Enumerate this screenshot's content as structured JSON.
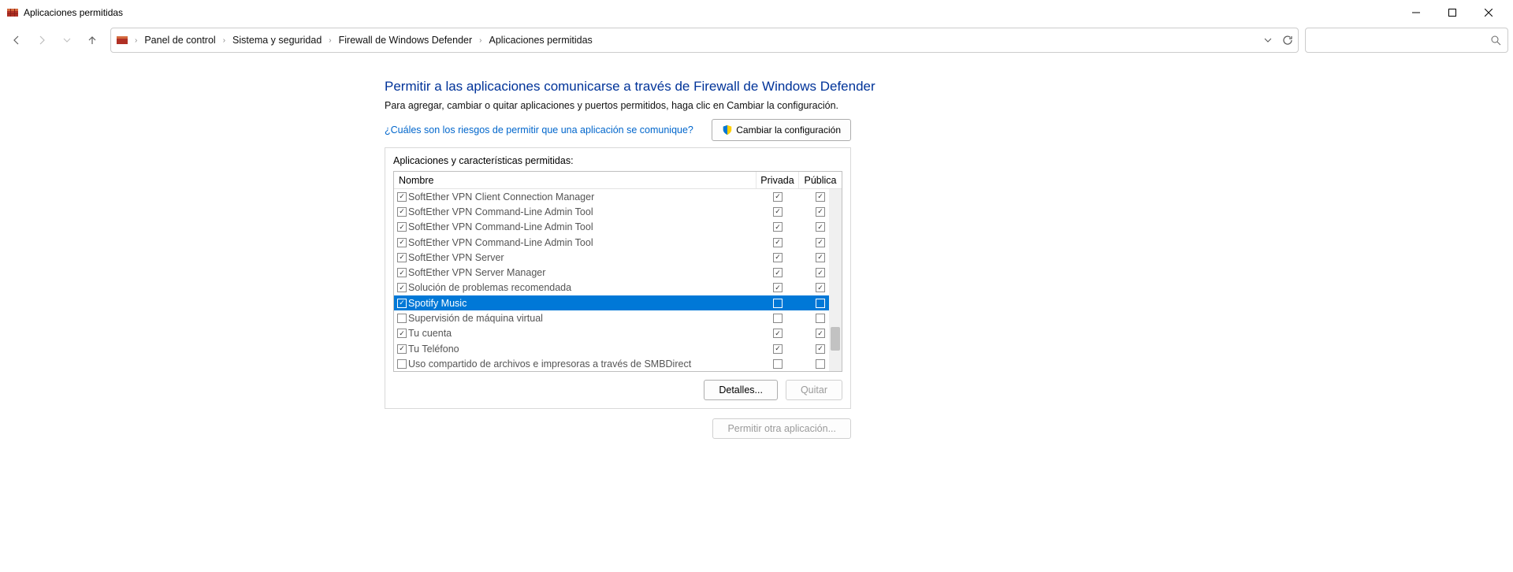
{
  "titlebar": {
    "title": "Aplicaciones permitidas"
  },
  "breadcrumb": [
    "Panel de control",
    "Sistema y seguridad",
    "Firewall de Windows Defender",
    "Aplicaciones permitidas"
  ],
  "heading": "Permitir a las aplicaciones comunicarse a través de Firewall de Windows Defender",
  "subtext": "Para agregar, cambiar o quitar aplicaciones y puertos permitidos, haga clic en Cambiar la configuración.",
  "risklink": "¿Cuáles son los riesgos de permitir que una aplicación se comunique?",
  "changebtn": "Cambiar la configuración",
  "panel_label": "Aplicaciones y características permitidas:",
  "cols": {
    "name": "Nombre",
    "private": "Privada",
    "public": "Pública"
  },
  "rows": [
    {
      "enabled": true,
      "name": "SoftEther VPN Client Connection Manager",
      "priv": true,
      "pub": true,
      "selected": false
    },
    {
      "enabled": true,
      "name": "SoftEther VPN Command-Line Admin Tool",
      "priv": true,
      "pub": true,
      "selected": false
    },
    {
      "enabled": true,
      "name": "SoftEther VPN Command-Line Admin Tool",
      "priv": true,
      "pub": true,
      "selected": false
    },
    {
      "enabled": true,
      "name": "SoftEther VPN Command-Line Admin Tool",
      "priv": true,
      "pub": true,
      "selected": false
    },
    {
      "enabled": true,
      "name": "SoftEther VPN Server",
      "priv": true,
      "pub": true,
      "selected": false
    },
    {
      "enabled": true,
      "name": "SoftEther VPN Server Manager",
      "priv": true,
      "pub": true,
      "selected": false
    },
    {
      "enabled": true,
      "name": "Solución de problemas recomendada",
      "priv": true,
      "pub": true,
      "selected": false
    },
    {
      "enabled": true,
      "name": "Spotify Music",
      "priv": false,
      "pub": false,
      "selected": true
    },
    {
      "enabled": false,
      "name": "Supervisión de máquina virtual",
      "priv": false,
      "pub": false,
      "selected": false
    },
    {
      "enabled": true,
      "name": "Tu cuenta",
      "priv": true,
      "pub": true,
      "selected": false
    },
    {
      "enabled": true,
      "name": "Tu Teléfono",
      "priv": true,
      "pub": true,
      "selected": false
    },
    {
      "enabled": false,
      "name": "Uso compartido de archivos e impresoras a través de SMBDirect",
      "priv": false,
      "pub": false,
      "selected": false
    }
  ],
  "buttons": {
    "details": "Detalles...",
    "remove": "Quitar",
    "allow_other": "Permitir otra aplicación..."
  }
}
